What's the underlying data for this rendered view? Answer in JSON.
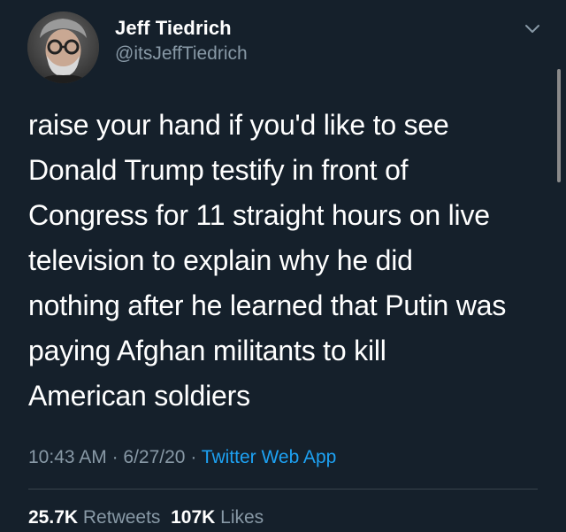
{
  "author": {
    "display_name": "Jeff Tiedrich",
    "handle": "@itsJeffTiedrich",
    "avatar_icon": "profile-photo"
  },
  "tweet": {
    "text": "raise your hand if you'd like to see\nDonald Trump testify in front of\nCongress for 11 straight hours on live\ntelevision to explain why he did\nnothing after he learned that Putin was\npaying Afghan militants to kill\nAmerican soldiers"
  },
  "meta": {
    "time": "10:43 AM",
    "separator": " · ",
    "date": "6/27/20",
    "source": "Twitter Web App"
  },
  "stats": {
    "retweets_count": "25.7K",
    "retweets_label": "Retweets",
    "likes_count": "107K",
    "likes_label": "Likes"
  },
  "colors": {
    "background": "#15202b",
    "secondary_text": "#8899a6",
    "link": "#1da1f2",
    "divider": "#38444d"
  },
  "icons": {
    "menu": "chevron-down-icon"
  }
}
